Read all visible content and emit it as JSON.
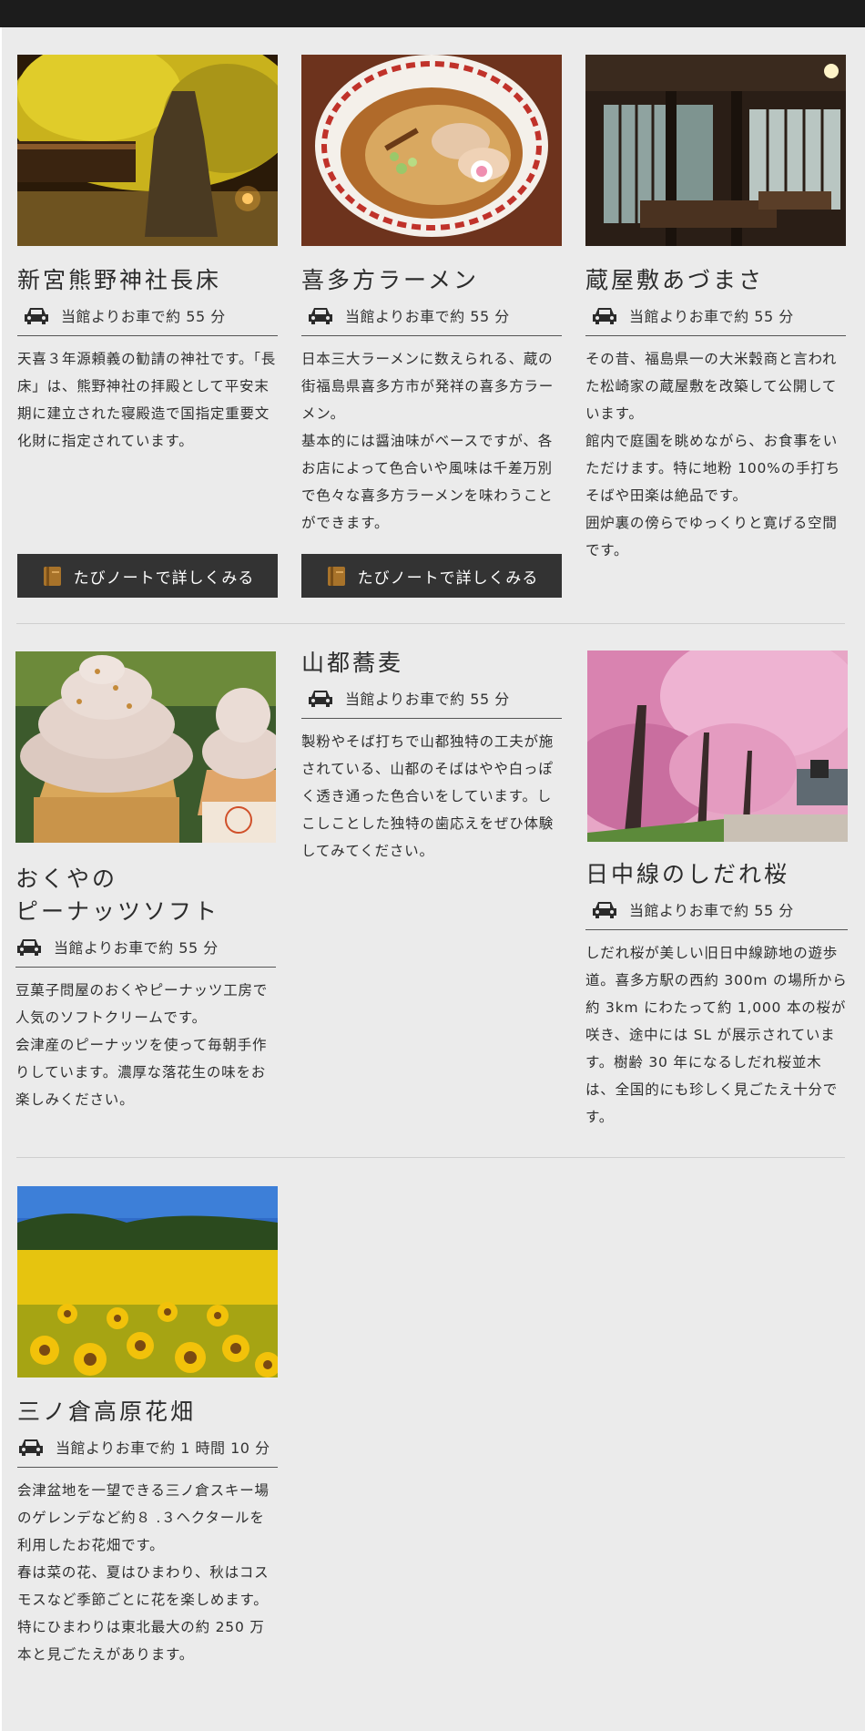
{
  "cards": [
    {
      "title": "新宮熊野神社長床",
      "access": "当館よりお車で約 55 分",
      "desc": [
        "天喜３年源頼義の勧請の神社です。「長床」は、熊野神社の拝殿として平安末期に建立された寝殿造で国指定重要文化財に指定されています。"
      ],
      "button": "たびノートで詳しくみる"
    },
    {
      "title": "喜多方ラーメン",
      "access": "当館よりお車で約 55 分",
      "desc": [
        "日本三大ラーメンに数えられる、蔵の街福島県喜多方市が発祥の喜多方ラーメン。",
        "基本的には醤油味がベースですが、各お店によって色合いや風味は千差万別で色々な喜多方ラーメンを味わうことができます。"
      ],
      "button": "たびノートで詳しくみる"
    },
    {
      "title": "蔵屋敷あづまさ",
      "access": "当館よりお車で約 55 分",
      "desc": [
        "その昔、福島県一の大米穀商と言われた松崎家の蔵屋敷を改築して公開しています。",
        "館内で庭園を眺めながら、お食事をいただけます。特に地粉 100%の手打ちそばや田楽は絶品です。",
        "囲炉裏の傍らでゆっくりと寛げる空間です。"
      ]
    },
    {
      "title": "おくやの\nピーナッツソフト",
      "title_line1": "おくやの",
      "title_line2": "ピーナッツソフト",
      "access": "当館よりお車で約 55 分",
      "desc": [
        "豆菓子問屋のおくやピーナッツ工房で人気のソフトクリームです。",
        "会津産のピーナッツを使って毎朝手作りしています。濃厚な落花生の味をお楽しみください。"
      ]
    },
    {
      "title": "山都蕎麦",
      "access": "当館よりお車で約 55 分",
      "desc": [
        "製粉やそば打ちで山都独特の工夫が施されている、山都のそばはやや白っぽく透き通った色合いをしています。しこしことした独特の歯応えをぜひ体験してみてください。"
      ]
    },
    {
      "title": "日中線のしだれ桜",
      "access": "当館よりお車で約 55 分",
      "desc": [
        "しだれ桜が美しい旧日中線跡地の遊歩道。喜多方駅の西約 300m の場所から約 3km にわたって約 1,000 本の桜が咲き、途中には SL が展示されています。樹齢 30 年になるしだれ桜並木は、全国的にも珍しく見ごたえ十分です。"
      ]
    },
    {
      "title": "三ノ倉高原花畑",
      "access": "当館よりお車で約 1 時間 10 分",
      "desc": [
        "会津盆地を一望できる三ノ倉スキー場のゲレンデなど約８ .３ヘクタールを利用したお花畑です。",
        "春は菜の花、夏はひまわり、秋はコスモスなど季節ごとに花を楽しめます。",
        "特にひまわりは東北最大の約 250 万本と見ごたえがあります。"
      ]
    }
  ],
  "icons": {
    "car": "car-icon",
    "book": "book-icon"
  },
  "colors": {
    "topbar": "#1c1c1c",
    "background": "#ebebeb",
    "button": "#333333"
  }
}
